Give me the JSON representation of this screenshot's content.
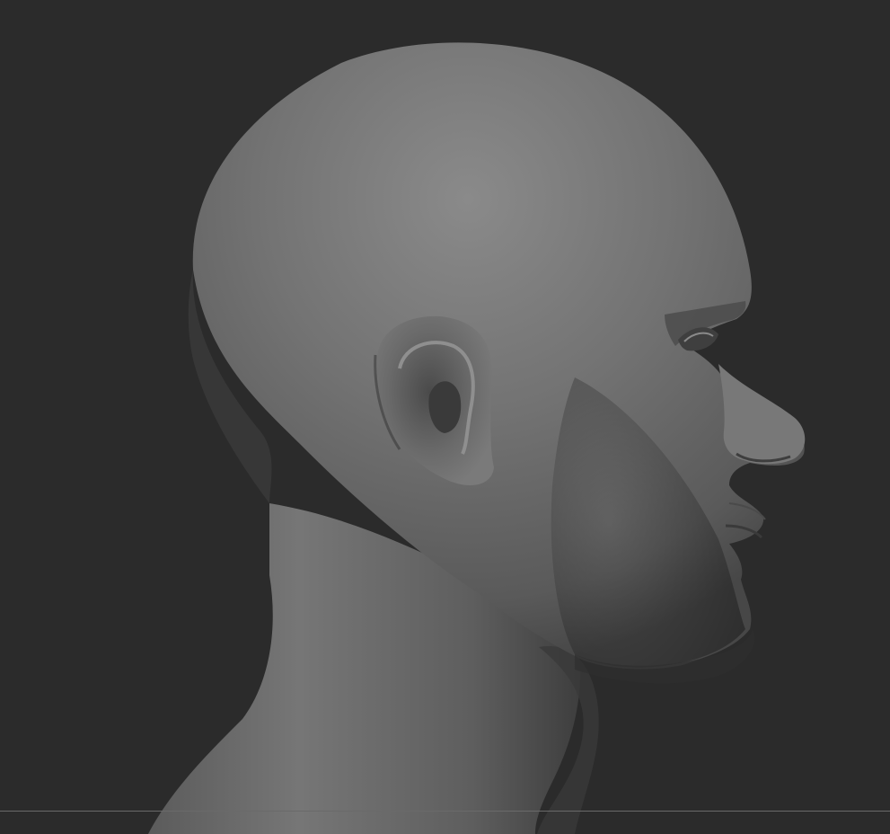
{
  "scene": {
    "subject": "bust",
    "background_color": "#2b2b2b",
    "material_color": "#6e6e6e",
    "highlight_color": "#8c8c8c",
    "shadow_color": "#3a3a3a"
  }
}
